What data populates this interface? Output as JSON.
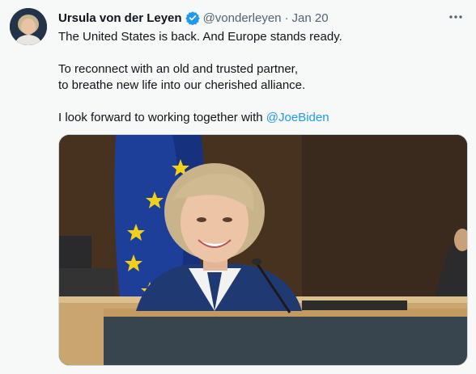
{
  "tweet": {
    "author_name": "Ursula von der Leyen",
    "handle": "@vonderleyen",
    "separator": "·",
    "date": "Jan 20",
    "lines": [
      "The United States is back. And Europe stands ready.",
      "To reconnect with an old and trusted partner,",
      "to breathe new life into our cherished alliance.",
      "I look forward to working together with "
    ],
    "mention": "@JoeBiden"
  },
  "icons": {
    "verified": "verified-badge-icon",
    "more": "more-options-icon"
  },
  "colors": {
    "accent": "#1d9bf0",
    "text": "#0f1419",
    "secondary": "#536471"
  }
}
